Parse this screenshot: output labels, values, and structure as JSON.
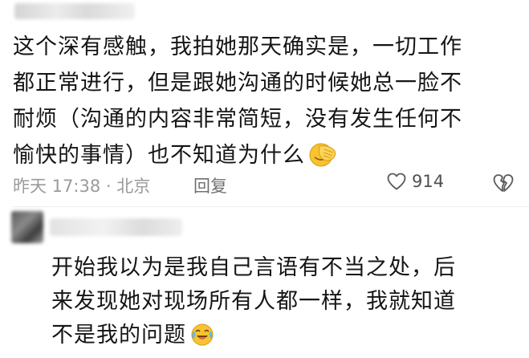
{
  "comment": {
    "lines": [
      "这个深有感触，我拍她那天确实是，一切工作",
      "都正常进行，但是跟她沟通的时候她总一脸不",
      "耐烦（沟通的内容非常简短，没有发生任何不",
      "愉快的事情）也不知道为什么"
    ],
    "emoji": "facepalm-emoji",
    "meta": {
      "time_location": "昨天 17:38 · 北京",
      "reply_label": "回复",
      "like_count": "914",
      "like_icon": "heart-outline-icon",
      "dislike_icon": "broken-heart-icon"
    }
  },
  "reply": {
    "lines": [
      "开始我以为是我自己言语有不当之处，后",
      "来发现她对现场所有人都一样，我就知道",
      "不是我的问题"
    ],
    "emoji": "crying-laughing-emoji"
  },
  "colors": {
    "text": "#151515",
    "meta_text": "#9a9a9a",
    "emoji_yellow": "#f7c331",
    "divider": "#ececec"
  }
}
